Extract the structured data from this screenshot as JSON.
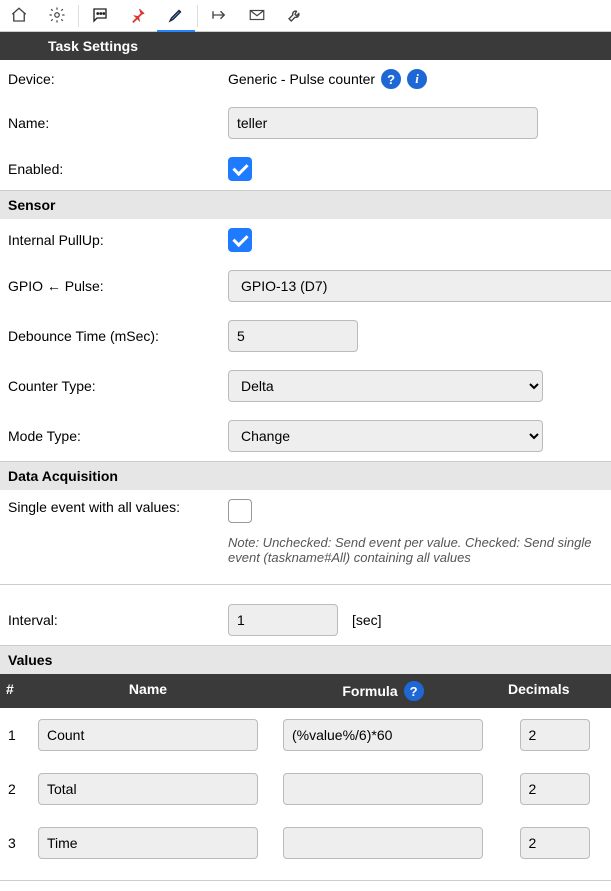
{
  "header": {
    "title": "Task Settings"
  },
  "device": {
    "label": "Device:",
    "value": "Generic - Pulse counter"
  },
  "name": {
    "label": "Name:",
    "value": "teller"
  },
  "enabled": {
    "label": "Enabled:",
    "checked": true
  },
  "sensor": {
    "header": "Sensor",
    "pullup": {
      "label": "Internal PullUp:",
      "checked": true
    },
    "gpio": {
      "label": "GPIO ← Pulse:",
      "value": "GPIO-13 (D7)"
    },
    "debounce": {
      "label": "Debounce Time (mSec):",
      "value": "5"
    },
    "counter_type": {
      "label": "Counter Type:",
      "value": "Delta"
    },
    "mode_type": {
      "label": "Mode Type:",
      "value": "Change"
    }
  },
  "data_acq": {
    "header": "Data Acquisition",
    "single_event": {
      "label": "Single event with all values:",
      "checked": false,
      "note": "Note: Unchecked: Send event per value. Checked: Send single event (taskname#All) containing all values"
    },
    "interval": {
      "label": "Interval:",
      "value": "1",
      "unit": "[sec]"
    }
  },
  "values": {
    "header": "Values",
    "columns": {
      "idx": "#",
      "name": "Name",
      "formula": "Formula",
      "decimals": "Decimals"
    },
    "rows": [
      {
        "idx": "1",
        "name": "Count",
        "formula": "(%value%/6)*60",
        "decimals": "2"
      },
      {
        "idx": "2",
        "name": "Total",
        "formula": "",
        "decimals": "2"
      },
      {
        "idx": "3",
        "name": "Time",
        "formula": "",
        "decimals": "2"
      }
    ]
  }
}
